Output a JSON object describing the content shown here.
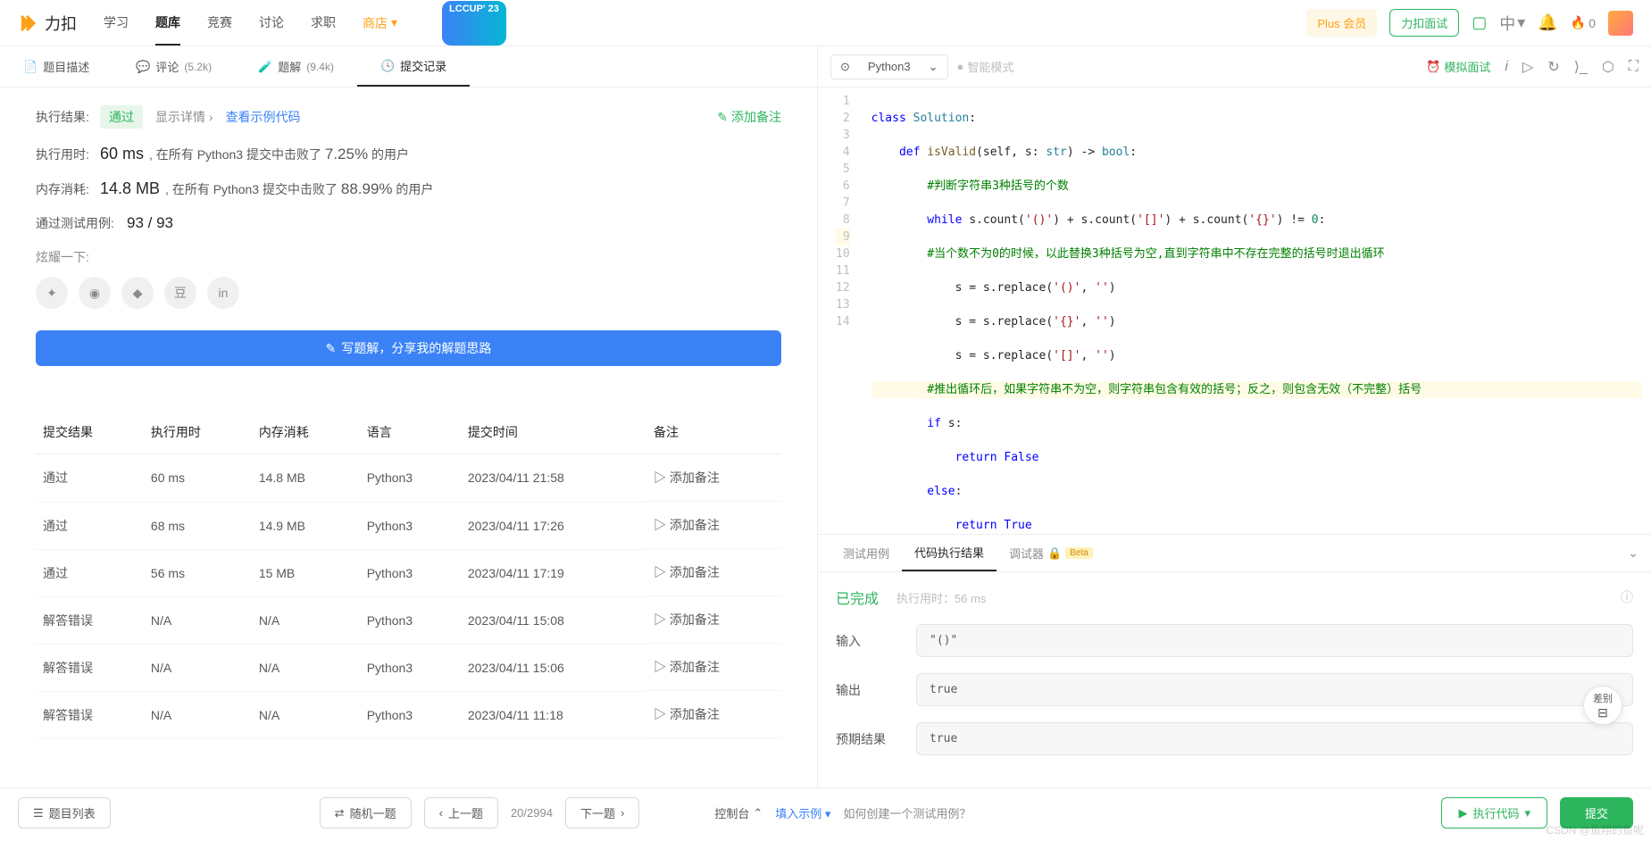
{
  "brand": "力扣",
  "nav": {
    "items": [
      "学习",
      "题库",
      "竞赛",
      "讨论",
      "求职",
      "商店"
    ],
    "activeIndex": 1,
    "lccup": "LCCUP' 23"
  },
  "navRight": {
    "plus": "Plus 会员",
    "interview": "力扣面试",
    "lang": "中",
    "fire": "0"
  },
  "leftTabs": {
    "desc": "题目描述",
    "comments": {
      "label": "评论",
      "count": "(5.2k)"
    },
    "solutions": {
      "label": "题解",
      "count": "(9.4k)"
    },
    "submissions": "提交记录"
  },
  "result": {
    "execLabel": "执行结果:",
    "status": "通过",
    "showDetails": "显示详情",
    "sampleCode": "查看示例代码",
    "addNote": "添加备注",
    "timeLabel": "执行用时:",
    "time": "60 ms",
    "timeDesc1": ", 在所有 Python3 提交中击败了 ",
    "timePct": "7.25%",
    "timeDesc2": " 的用户",
    "memLabel": "内存消耗:",
    "mem": "14.8 MB",
    "memDesc1": ", 在所有 Python3 提交中击败了 ",
    "memPct": "88.99%",
    "memDesc2": " 的用户",
    "testLabel": "通过测试用例:",
    "testCount": "93 / 93",
    "shareLabel": "炫耀一下:",
    "writeBtn": "写题解，分享我的解题思路"
  },
  "subTable": {
    "headers": [
      "提交结果",
      "执行用时",
      "内存消耗",
      "语言",
      "提交时间",
      "备注"
    ],
    "noteText": "添加备注",
    "rows": [
      {
        "status": "通过",
        "pass": true,
        "time": "60 ms",
        "mem": "14.8 MB",
        "lang": "Python3",
        "ts": "2023/04/11 21:58"
      },
      {
        "status": "通过",
        "pass": true,
        "time": "68 ms",
        "mem": "14.9 MB",
        "lang": "Python3",
        "ts": "2023/04/11 17:26"
      },
      {
        "status": "通过",
        "pass": true,
        "time": "56 ms",
        "mem": "15 MB",
        "lang": "Python3",
        "ts": "2023/04/11 17:19"
      },
      {
        "status": "解答错误",
        "pass": false,
        "time": "N/A",
        "mem": "N/A",
        "lang": "Python3",
        "ts": "2023/04/11 15:08"
      },
      {
        "status": "解答错误",
        "pass": false,
        "time": "N/A",
        "mem": "N/A",
        "lang": "Python3",
        "ts": "2023/04/11 15:06"
      },
      {
        "status": "解答错误",
        "pass": false,
        "time": "N/A",
        "mem": "N/A",
        "lang": "Python3",
        "ts": "2023/04/11 11:18"
      }
    ]
  },
  "editor": {
    "lang": "Python3",
    "smartMode": "智能模式",
    "mockInterview": "模拟面试",
    "code": {
      "l1": {
        "a": "class ",
        "b": "Solution",
        "c": ":"
      },
      "l2": {
        "a": "def ",
        "b": "isValid",
        "c": "(self, s: ",
        "d": "str",
        "e": ") -> ",
        "f": "bool",
        "g": ":"
      },
      "l3": "#判断字符串3种括号的个数",
      "l4": {
        "a": "while ",
        "b": "s.count(",
        "c": "'()'",
        "d": ") + s.count(",
        "e": "'[]'",
        "f": ") + s.count(",
        "g": "'{}'",
        "h": ") != ",
        "i": "0",
        "j": ":"
      },
      "l5": "#当个数不为0的时候，以此替换3种括号为空,直到字符串中不存在完整的括号时退出循环",
      "l6": {
        "a": "s = s.replace(",
        "b": "'()'",
        "c": ", ",
        "d": "''",
        "e": ")"
      },
      "l7": {
        "a": "s = s.replace(",
        "b": "'{}'",
        "c": ", ",
        "d": "''",
        "e": ")"
      },
      "l8": {
        "a": "s = s.replace(",
        "b": "'[]'",
        "c": ", ",
        "d": "''",
        "e": ")"
      },
      "l9": "#推出循环后，如果字符串不为空，则字符串包含有效的括号；反之，则包含无效（不完整）括号",
      "l10": {
        "a": "if ",
        "b": "s:"
      },
      "l11": {
        "a": "return ",
        "b": "False"
      },
      "l12": {
        "a": "else",
        "b": ":"
      },
      "l13": {
        "a": "return ",
        "b": "True"
      }
    }
  },
  "resultPanel": {
    "tabs": {
      "testcase": "测试用例",
      "result": "代码执行结果",
      "debugger": "调试器",
      "beta": "Beta"
    },
    "status": "已完成",
    "timeLabel": "执行用时：",
    "time": "56 ms",
    "inputLabel": "输入",
    "input": "\"()\"",
    "outputLabel": "输出",
    "output": "true",
    "expectedLabel": "预期结果",
    "expected": "true",
    "diffBtn": "差别"
  },
  "bottomBar": {
    "problemList": "题目列表",
    "random": "随机一题",
    "prev": "上一题",
    "next": "下一题",
    "pager": "20/2994",
    "console": "控制台",
    "fillExample": "填入示例",
    "howCreate": "如何创建一个测试用例？",
    "run": "执行代码",
    "submit": "提交"
  },
  "watermark": "CSDN @鱼翔的鱼呢"
}
